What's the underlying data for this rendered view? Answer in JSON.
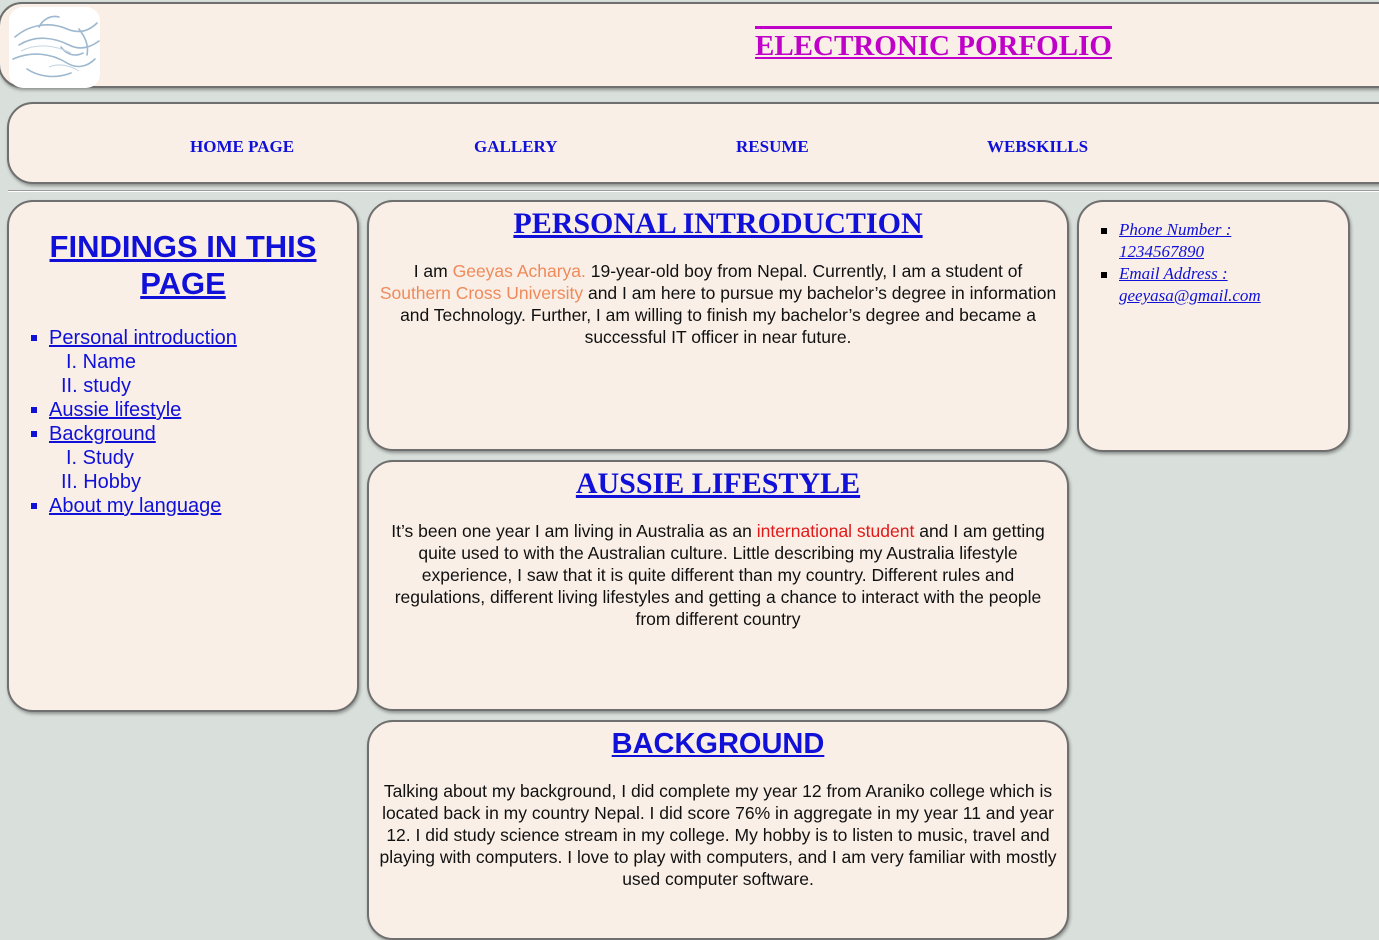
{
  "header": {
    "title": "ELECTRONIC PORFOLIO",
    "logo_icon": "dolphin-logo-icon"
  },
  "nav": {
    "items": [
      {
        "label": "HOME PAGE"
      },
      {
        "label": "GALLERY"
      },
      {
        "label": "RESUME"
      },
      {
        "label": "WEBSKILLS"
      }
    ]
  },
  "sidebar": {
    "title": "FINDINGS IN THIS PAGE",
    "toc": [
      {
        "label": "Personal introduction"
      },
      {
        "label": "I. Name"
      },
      {
        "label": "II. study"
      },
      {
        "label": "Aussie lifestyle"
      },
      {
        "label": "Background"
      },
      {
        "label": "I. Study"
      },
      {
        "label": "II. Hobby"
      },
      {
        "label": "About my language"
      }
    ]
  },
  "sections": {
    "intro": {
      "title": "PERSONAL INTRODUCTION",
      "t1": "I am ",
      "name": "Geeyas Acharya.",
      "t2": " 19-year-old boy from Nepal. Currently, I am a student of ",
      "university": "Southern Cross University",
      "t3": " and I am here to pursue my bachelor’s degree in information and Technology. Further, I am willing to finish my bachelor’s degree and became a successful IT officer in near future."
    },
    "aussie": {
      "title": "AUSSIE LIFESTYLE",
      "t1": "It’s been one year I am living in Australia as an ",
      "highlight": "international student",
      "t2": " and I am getting quite used to with the Australian culture. Little describing my Australia lifestyle experience, I saw that it is quite different than my country. Different rules and regulations, different living lifestyles and getting a chance to interact with the people from different country"
    },
    "background": {
      "title": "BACKGROUND",
      "text": "Talking about my background, I did complete my year 12 from Araniko college which is located back in my country Nepal. I did score 76% in aggregate in my year 11 and year 12. I did study science stream in my college. My hobby is to listen to music, travel and playing with computers. I love to play with computers, and I am very familiar with mostly used computer software."
    }
  },
  "contact": {
    "phone": "Phone Number : 1234567890",
    "email": "Email Address : geeyasa@gmail.com"
  },
  "colors": {
    "background": "#d9dfda",
    "panel": "#f9efe7",
    "link": "#1010d8",
    "title": "#c000c8",
    "name_highlight": "#f08a5a",
    "student_highlight": "#e01818"
  }
}
